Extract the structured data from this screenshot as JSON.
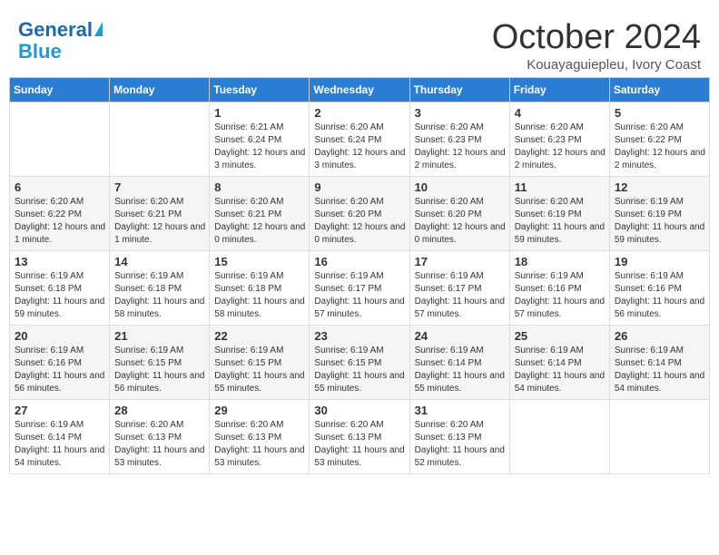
{
  "header": {
    "logo_line1": "General",
    "logo_line2": "Blue",
    "month": "October 2024",
    "location": "Kouayaguiepleu, Ivory Coast"
  },
  "weekdays": [
    "Sunday",
    "Monday",
    "Tuesday",
    "Wednesday",
    "Thursday",
    "Friday",
    "Saturday"
  ],
  "weeks": [
    [
      {
        "day": "",
        "content": ""
      },
      {
        "day": "",
        "content": ""
      },
      {
        "day": "1",
        "content": "Sunrise: 6:21 AM\nSunset: 6:24 PM\nDaylight: 12 hours and 3 minutes."
      },
      {
        "day": "2",
        "content": "Sunrise: 6:20 AM\nSunset: 6:24 PM\nDaylight: 12 hours and 3 minutes."
      },
      {
        "day": "3",
        "content": "Sunrise: 6:20 AM\nSunset: 6:23 PM\nDaylight: 12 hours and 2 minutes."
      },
      {
        "day": "4",
        "content": "Sunrise: 6:20 AM\nSunset: 6:23 PM\nDaylight: 12 hours and 2 minutes."
      },
      {
        "day": "5",
        "content": "Sunrise: 6:20 AM\nSunset: 6:22 PM\nDaylight: 12 hours and 2 minutes."
      }
    ],
    [
      {
        "day": "6",
        "content": "Sunrise: 6:20 AM\nSunset: 6:22 PM\nDaylight: 12 hours and 1 minute."
      },
      {
        "day": "7",
        "content": "Sunrise: 6:20 AM\nSunset: 6:21 PM\nDaylight: 12 hours and 1 minute."
      },
      {
        "day": "8",
        "content": "Sunrise: 6:20 AM\nSunset: 6:21 PM\nDaylight: 12 hours and 0 minutes."
      },
      {
        "day": "9",
        "content": "Sunrise: 6:20 AM\nSunset: 6:20 PM\nDaylight: 12 hours and 0 minutes."
      },
      {
        "day": "10",
        "content": "Sunrise: 6:20 AM\nSunset: 6:20 PM\nDaylight: 12 hours and 0 minutes."
      },
      {
        "day": "11",
        "content": "Sunrise: 6:20 AM\nSunset: 6:19 PM\nDaylight: 11 hours and 59 minutes."
      },
      {
        "day": "12",
        "content": "Sunrise: 6:19 AM\nSunset: 6:19 PM\nDaylight: 11 hours and 59 minutes."
      }
    ],
    [
      {
        "day": "13",
        "content": "Sunrise: 6:19 AM\nSunset: 6:18 PM\nDaylight: 11 hours and 59 minutes."
      },
      {
        "day": "14",
        "content": "Sunrise: 6:19 AM\nSunset: 6:18 PM\nDaylight: 11 hours and 58 minutes."
      },
      {
        "day": "15",
        "content": "Sunrise: 6:19 AM\nSunset: 6:18 PM\nDaylight: 11 hours and 58 minutes."
      },
      {
        "day": "16",
        "content": "Sunrise: 6:19 AM\nSunset: 6:17 PM\nDaylight: 11 hours and 57 minutes."
      },
      {
        "day": "17",
        "content": "Sunrise: 6:19 AM\nSunset: 6:17 PM\nDaylight: 11 hours and 57 minutes."
      },
      {
        "day": "18",
        "content": "Sunrise: 6:19 AM\nSunset: 6:16 PM\nDaylight: 11 hours and 57 minutes."
      },
      {
        "day": "19",
        "content": "Sunrise: 6:19 AM\nSunset: 6:16 PM\nDaylight: 11 hours and 56 minutes."
      }
    ],
    [
      {
        "day": "20",
        "content": "Sunrise: 6:19 AM\nSunset: 6:16 PM\nDaylight: 11 hours and 56 minutes."
      },
      {
        "day": "21",
        "content": "Sunrise: 6:19 AM\nSunset: 6:15 PM\nDaylight: 11 hours and 56 minutes."
      },
      {
        "day": "22",
        "content": "Sunrise: 6:19 AM\nSunset: 6:15 PM\nDaylight: 11 hours and 55 minutes."
      },
      {
        "day": "23",
        "content": "Sunrise: 6:19 AM\nSunset: 6:15 PM\nDaylight: 11 hours and 55 minutes."
      },
      {
        "day": "24",
        "content": "Sunrise: 6:19 AM\nSunset: 6:14 PM\nDaylight: 11 hours and 55 minutes."
      },
      {
        "day": "25",
        "content": "Sunrise: 6:19 AM\nSunset: 6:14 PM\nDaylight: 11 hours and 54 minutes."
      },
      {
        "day": "26",
        "content": "Sunrise: 6:19 AM\nSunset: 6:14 PM\nDaylight: 11 hours and 54 minutes."
      }
    ],
    [
      {
        "day": "27",
        "content": "Sunrise: 6:19 AM\nSunset: 6:14 PM\nDaylight: 11 hours and 54 minutes."
      },
      {
        "day": "28",
        "content": "Sunrise: 6:20 AM\nSunset: 6:13 PM\nDaylight: 11 hours and 53 minutes."
      },
      {
        "day": "29",
        "content": "Sunrise: 6:20 AM\nSunset: 6:13 PM\nDaylight: 11 hours and 53 minutes."
      },
      {
        "day": "30",
        "content": "Sunrise: 6:20 AM\nSunset: 6:13 PM\nDaylight: 11 hours and 53 minutes."
      },
      {
        "day": "31",
        "content": "Sunrise: 6:20 AM\nSunset: 6:13 PM\nDaylight: 11 hours and 52 minutes."
      },
      {
        "day": "",
        "content": ""
      },
      {
        "day": "",
        "content": ""
      }
    ]
  ]
}
